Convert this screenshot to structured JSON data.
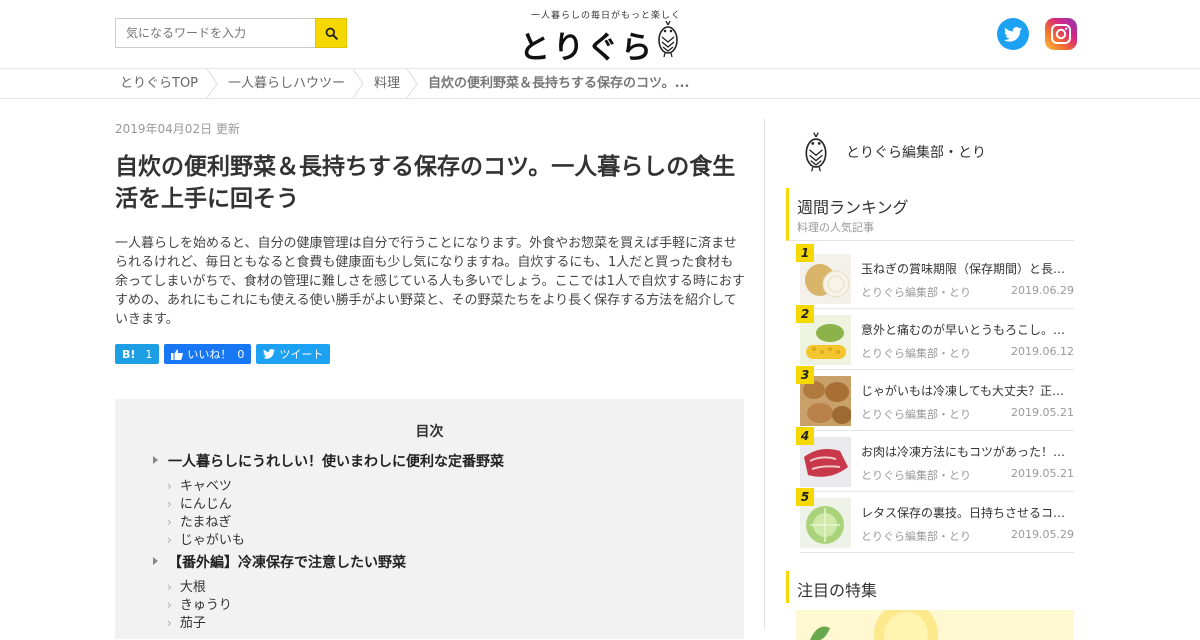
{
  "header": {
    "search_placeholder": "気になるワードを入力",
    "logo_tagline": "一人暮らしの毎日がもっと楽しく",
    "logo_text": "とりぐら",
    "brand_color": "#f5d800"
  },
  "breadcrumb": [
    "とりぐらTOP",
    "一人暮らしハウツー",
    "料理",
    "自炊の便利野菜＆長持ちする保存のコツ。..."
  ],
  "article": {
    "date": "2019年04月02日 更新",
    "title": "自炊の便利野菜＆長持ちする保存のコツ。一人暮らしの食生活を上手に回そう",
    "lead": "一人暮らしを始めると、自分の健康管理は自分で行うことになります。外食やお惣菜を買えば手軽に済ませられるけれど、毎日ともなると食費も健康面も少し気になりますね。自炊するにも、1人だと買った食材も余ってしまいがちで、食材の管理に難しさを感じている人も多いでしょう。ここでは1人で自炊する時におすすめの、あれにもこれにも使える使い勝手がよい野菜と、その野菜たちをより長く保存する方法を紹介していきます。",
    "share": {
      "hatena_label": "B!",
      "hatena_count": "1",
      "fb_label": "いいね！",
      "fb_count": "0",
      "tweet_label": "ツイート"
    }
  },
  "toc": {
    "title": "目次",
    "sections": [
      {
        "heading": "一人暮らしにうれしい！使いまわしに便利な定番野菜",
        "items": [
          "キャベツ",
          "にんじん",
          "たまねぎ",
          "じゃがいも"
        ]
      },
      {
        "heading": "【番外編】冷凍保存で注意したい野菜",
        "items": [
          "大根",
          "きゅうり",
          "茄子"
        ]
      }
    ]
  },
  "sidebar": {
    "author": "とりぐら編集部・とり",
    "ranking_title": "週間ランキング",
    "ranking_subtitle": "料理の人気記事",
    "ranking": [
      {
        "rank": "1",
        "title": "玉ねぎの賞味期限（保存期間）と長持ちさせる保存方法",
        "author": "とりぐら編集部・とり",
        "date": "2019.06.29"
      },
      {
        "rank": "2",
        "title": "意外と痛むのが早いとうもろこし。おいしく保存するには",
        "author": "とりぐら編集部・とり",
        "date": "2019.06.12"
      },
      {
        "rank": "3",
        "title": "じゃがいもは冷凍しても大丈夫？正しい保存方法",
        "author": "とりぐら編集部・とり",
        "date": "2019.05.21"
      },
      {
        "rank": "4",
        "title": "お肉は冷凍方法にもコツがあった！おいしく保存",
        "author": "とりぐら編集部・とり",
        "date": "2019.05.21"
      },
      {
        "rank": "5",
        "title": "レタス保存の裏技。日持ちさせるコツを紹介",
        "author": "とりぐら編集部・とり",
        "date": "2019.05.29"
      }
    ],
    "feature_title": "注目の特集"
  }
}
